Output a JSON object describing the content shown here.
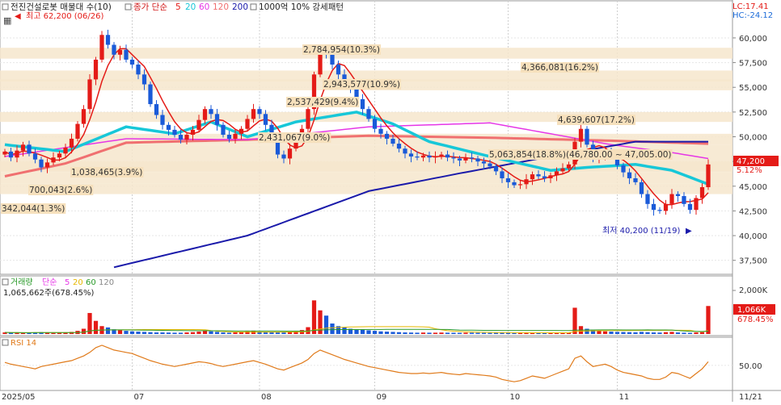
{
  "header": {
    "title": "전진건설로봇 매물대 수(10)",
    "ma_label": "종가 단순",
    "ma_periods": [
      "5",
      "20",
      "60",
      "120",
      "200"
    ],
    "ma_colors": [
      "#e41b17",
      "#17c7d8",
      "#e636e6",
      "#f07070",
      "#1a1aaa"
    ],
    "extra": "1000억 10% 강세패턴",
    "lc": "LC:17.41",
    "hc": "HC:-24.12"
  },
  "price_panel": {
    "high_label": "최고 62,200 (06/26)",
    "low_label": "최저 40,200 (11/19)",
    "current_price": "47,200",
    "current_change": "5.12%",
    "y_ticks": [
      "60,000",
      "57,500",
      "55,000",
      "52,500",
      "50,000",
      "47,500",
      "45,000",
      "42,500",
      "40,000",
      "37,500"
    ]
  },
  "volume_panel": {
    "label": "거래량",
    "ma_label": "단순",
    "ma_periods": [
      "5",
      "20",
      "60",
      "120"
    ],
    "ma_colors": [
      "#e636e6",
      "#e6b800",
      "#2a9a2a",
      "#888888"
    ],
    "summary": "1,065,662주(678.45%)",
    "y_tick": "2,000K",
    "current": "1,066K",
    "current_pct": "678.45%"
  },
  "rsi_panel": {
    "label": "RSI 14",
    "y_tick": "50.00"
  },
  "x_axis": {
    "labels": [
      "2025/05",
      "07",
      "08",
      "09",
      "10",
      "11",
      "11/21"
    ]
  },
  "chart_data": {
    "type": "candlestick",
    "price_axis": {
      "ylim": [
        36250,
        62200
      ],
      "ticks": [
        60000,
        57500,
        55000,
        52500,
        50000,
        47500,
        45000,
        42500,
        40000,
        37500
      ]
    },
    "volume_profile": [
      {
        "label": "342,044(1.3%)",
        "low": 44200,
        "high": 45300
      },
      {
        "label": "700,043(2.6%)",
        "low": 45300,
        "high": 46400
      },
      {
        "label": "1,038,465(3.9%)",
        "low": 46400,
        "high": 47500
      },
      {
        "label": "5,063,854(18.8%)(46,780.00 ~ 47,005.00)",
        "low": 46500,
        "high": 48000
      },
      {
        "label": "2,431,067(9.0%)",
        "low": 48000,
        "high": 49200
      },
      {
        "label": "4,639,607(17.2%)",
        "low": 49200,
        "high": 50300
      },
      {
        "label": "2,537,429(9.4%)",
        "low": 51500,
        "high": 52500
      },
      {
        "label": "2,943,577(10.9%)",
        "low": 54700,
        "high": 55800
      },
      {
        "label": "4,366,081(16.2%)",
        "low": 55600,
        "high": 56700
      },
      {
        "label": "2,784,954(10.3%)",
        "low": 57900,
        "high": 59000
      }
    ],
    "close": [
      48500,
      47900,
      48600,
      49200,
      48300,
      47700,
      46900,
      47400,
      47900,
      48300,
      48900,
      49800,
      51300,
      52800,
      55800,
      57800,
      60300,
      59300,
      58300,
      58800,
      57800,
      57300,
      56300,
      55300,
      53300,
      52200,
      51200,
      50700,
      50200,
      49700,
      50200,
      50700,
      51700,
      52800,
      52300,
      51200,
      50200,
      49800,
      50300,
      50800,
      51800,
      52800,
      52300,
      51200,
      49800,
      48200,
      47800,
      48800,
      49800,
      50800,
      52800,
      56300,
      58800,
      58300,
      57300,
      56300,
      55300,
      54800,
      53800,
      52800,
      51800,
      50800,
      50300,
      49800,
      49300,
      48800,
      48300,
      48000,
      47900,
      48100,
      47900,
      48000,
      48200,
      47900,
      47800,
      47600,
      47900,
      47800,
      47500,
      47300,
      47000,
      46500,
      45800,
      45400,
      45100,
      45200,
      45700,
      46200,
      46000,
      45800,
      46100,
      46500,
      46800,
      47200,
      49500,
      50800,
      49200,
      47800,
      48200,
      48500,
      48000,
      47100,
      46400,
      45800,
      45400,
      44200,
      43200,
      42600,
      42500,
      43200,
      44200,
      44000,
      43200,
      42600,
      43800,
      44900,
      47200
    ],
    "ma20_anchor": [
      [
        0,
        49200
      ],
      [
        10,
        48500
      ],
      [
        20,
        51000
      ],
      [
        28,
        50300
      ],
      [
        34,
        51500
      ],
      [
        40,
        50000
      ],
      [
        48,
        51500
      ],
      [
        58,
        52500
      ],
      [
        64,
        51300
      ],
      [
        70,
        49500
      ],
      [
        80,
        48000
      ],
      [
        90,
        46600
      ],
      [
        96,
        46900
      ],
      [
        104,
        47200
      ],
      [
        110,
        46600
      ],
      [
        116,
        45200
      ]
    ],
    "ma60_anchor": [
      [
        0,
        48000
      ],
      [
        20,
        49800
      ],
      [
        40,
        49700
      ],
      [
        60,
        51000
      ],
      [
        80,
        51400
      ],
      [
        90,
        50300
      ],
      [
        100,
        49200
      ],
      [
        110,
        48400
      ],
      [
        116,
        47800
      ]
    ],
    "ma120_anchor": [
      [
        0,
        46000
      ],
      [
        10,
        47300
      ],
      [
        20,
        49400
      ],
      [
        40,
        49700
      ],
      [
        60,
        50100
      ],
      [
        80,
        49900
      ],
      [
        100,
        49600
      ],
      [
        116,
        49300
      ]
    ],
    "ma200_anchor": [
      [
        18,
        36800
      ],
      [
        40,
        40000
      ],
      [
        60,
        44500
      ],
      [
        75,
        46300
      ],
      [
        90,
        48000
      ],
      [
        104,
        49500
      ],
      [
        116,
        49500
      ]
    ],
    "volume": [
      60,
      50,
      45,
      40,
      55,
      60,
      70,
      50,
      40,
      45,
      60,
      80,
      120,
      200,
      800,
      500,
      300,
      250,
      180,
      150,
      120,
      100,
      90,
      80,
      70,
      60,
      60,
      55,
      50,
      50,
      60,
      70,
      90,
      120,
      100,
      80,
      60,
      50,
      60,
      80,
      100,
      120,
      90,
      80,
      70,
      60,
      60,
      80,
      100,
      150,
      260,
      1280,
      900,
      700,
      400,
      300,
      250,
      200,
      180,
      160,
      140,
      120,
      100,
      90,
      80,
      70,
      60,
      55,
      50,
      55,
      50,
      50,
      55,
      50,
      48,
      45,
      50,
      48,
      45,
      42,
      40,
      45,
      50,
      45,
      40,
      42,
      48,
      50,
      45,
      42,
      45,
      48,
      50,
      55,
      1000,
      300,
      200,
      150,
      120,
      100,
      90,
      80,
      75,
      70,
      65,
      80,
      70,
      60,
      55,
      70,
      80,
      60,
      50,
      45,
      60,
      70,
      1066
    ],
    "volume_axis": {
      "ylim": [
        0,
        2150
      ],
      "tick": 2000
    },
    "rsi": [
      55,
      52,
      50,
      48,
      46,
      44,
      48,
      50,
      52,
      54,
      56,
      58,
      62,
      66,
      72,
      80,
      84,
      80,
      76,
      74,
      72,
      70,
      66,
      62,
      58,
      55,
      52,
      50,
      48,
      50,
      52,
      54,
      56,
      55,
      53,
      50,
      48,
      50,
      52,
      54,
      56,
      58,
      55,
      52,
      48,
      44,
      42,
      46,
      50,
      54,
      60,
      70,
      76,
      72,
      68,
      64,
      60,
      57,
      54,
      51,
      48,
      46,
      44,
      42,
      40,
      38,
      37,
      36,
      36,
      37,
      36,
      37,
      38,
      36,
      35,
      34,
      36,
      35,
      34,
      33,
      32,
      30,
      26,
      24,
      22,
      24,
      28,
      32,
      30,
      28,
      32,
      36,
      40,
      44,
      62,
      66,
      56,
      48,
      50,
      52,
      48,
      42,
      38,
      36,
      34,
      32,
      28,
      26,
      26,
      30,
      38,
      36,
      32,
      28,
      36,
      44,
      56
    ],
    "rsi_axis": {
      "ylim": [
        10,
        95
      ],
      "tick": 50
    },
    "x_labels": [
      {
        "i": 0,
        "label": "2025/05"
      },
      {
        "i": 21,
        "label": "07"
      },
      {
        "i": 42,
        "label": "08"
      },
      {
        "i": 61,
        "label": "09"
      },
      {
        "i": 83,
        "label": "10"
      },
      {
        "i": 101,
        "label": "11"
      },
      {
        "i": 117,
        "label": "11/21"
      }
    ]
  }
}
